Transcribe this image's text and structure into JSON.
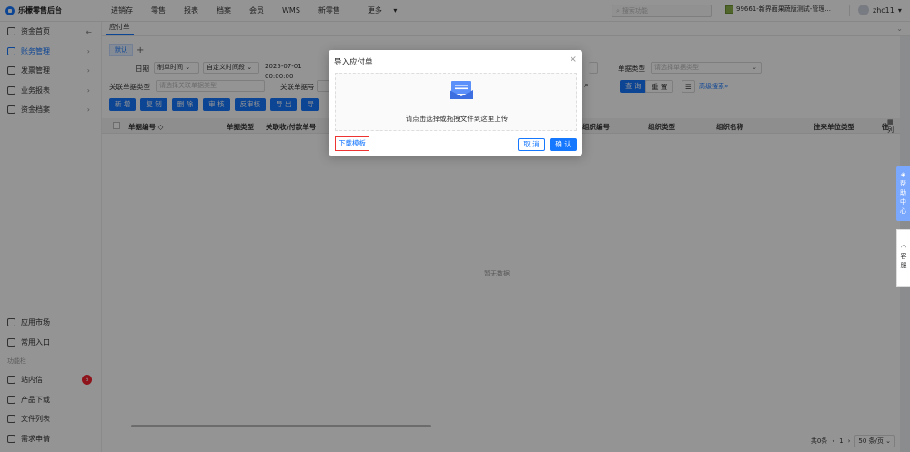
{
  "app": {
    "title": "乐檬零售后台"
  },
  "topnav": [
    "进销存",
    "零售",
    "报表",
    "档案",
    "会员",
    "WMS",
    "新零售",
    "更多"
  ],
  "search": {
    "placeholder": "搜索功能"
  },
  "store": {
    "name": "99661-新界面果蔬版测试-管理..."
  },
  "user": {
    "name": "zhc11"
  },
  "sidebar": {
    "items": [
      {
        "label": "资金首页"
      },
      {
        "label": "账务管理"
      },
      {
        "label": "发票管理"
      },
      {
        "label": "业务报表"
      },
      {
        "label": "资金档案"
      }
    ],
    "bottom": {
      "market": "应用市场",
      "common": "常用入口",
      "section": "功能栏",
      "inbox": "站内信",
      "inbox_count": "6",
      "download": "产品下载",
      "files": "文件列表",
      "request": "需求申请"
    }
  },
  "page_tab": "应付单",
  "subtab": "默认",
  "filters": {
    "date_label": "日期",
    "date_type": "制单时间",
    "date_range_type": "自定义时间段",
    "date_from": "2025-07-01 00:00:00",
    "link_type_label": "关联单据类型",
    "link_type_ph": "请选择关联单据类型",
    "link_no_label": "关联单据号",
    "doc_type_label": "单据类型",
    "doc_type_ph": "请选择单据类型",
    "query": "查 询",
    "reset": "重 置",
    "advanced": "高级搜索»"
  },
  "actions": [
    "新 增",
    "复 制",
    "删 除",
    "审 核",
    "反审核",
    "导 出",
    "导"
  ],
  "table": {
    "headers": [
      "单据编号",
      "单据类型",
      "关联收/付款单号",
      "组织编号",
      "组织类型",
      "组织名称",
      "往来单位类型",
      "往"
    ],
    "empty": "暂无数据",
    "side": "列",
    "pager": {
      "total": "共0条",
      "page": "1",
      "size": "50 条/页"
    }
  },
  "float": {
    "help": "帮助中心",
    "service": "客服"
  },
  "modal": {
    "title": "导入应付单",
    "drop_text": "请点击选择或拖拽文件到这里上传",
    "download": "下载模板",
    "cancel": "取 消",
    "ok": "确 认"
  },
  "colors": {
    "primary": "#1677ff",
    "danger": "#f5222d"
  }
}
